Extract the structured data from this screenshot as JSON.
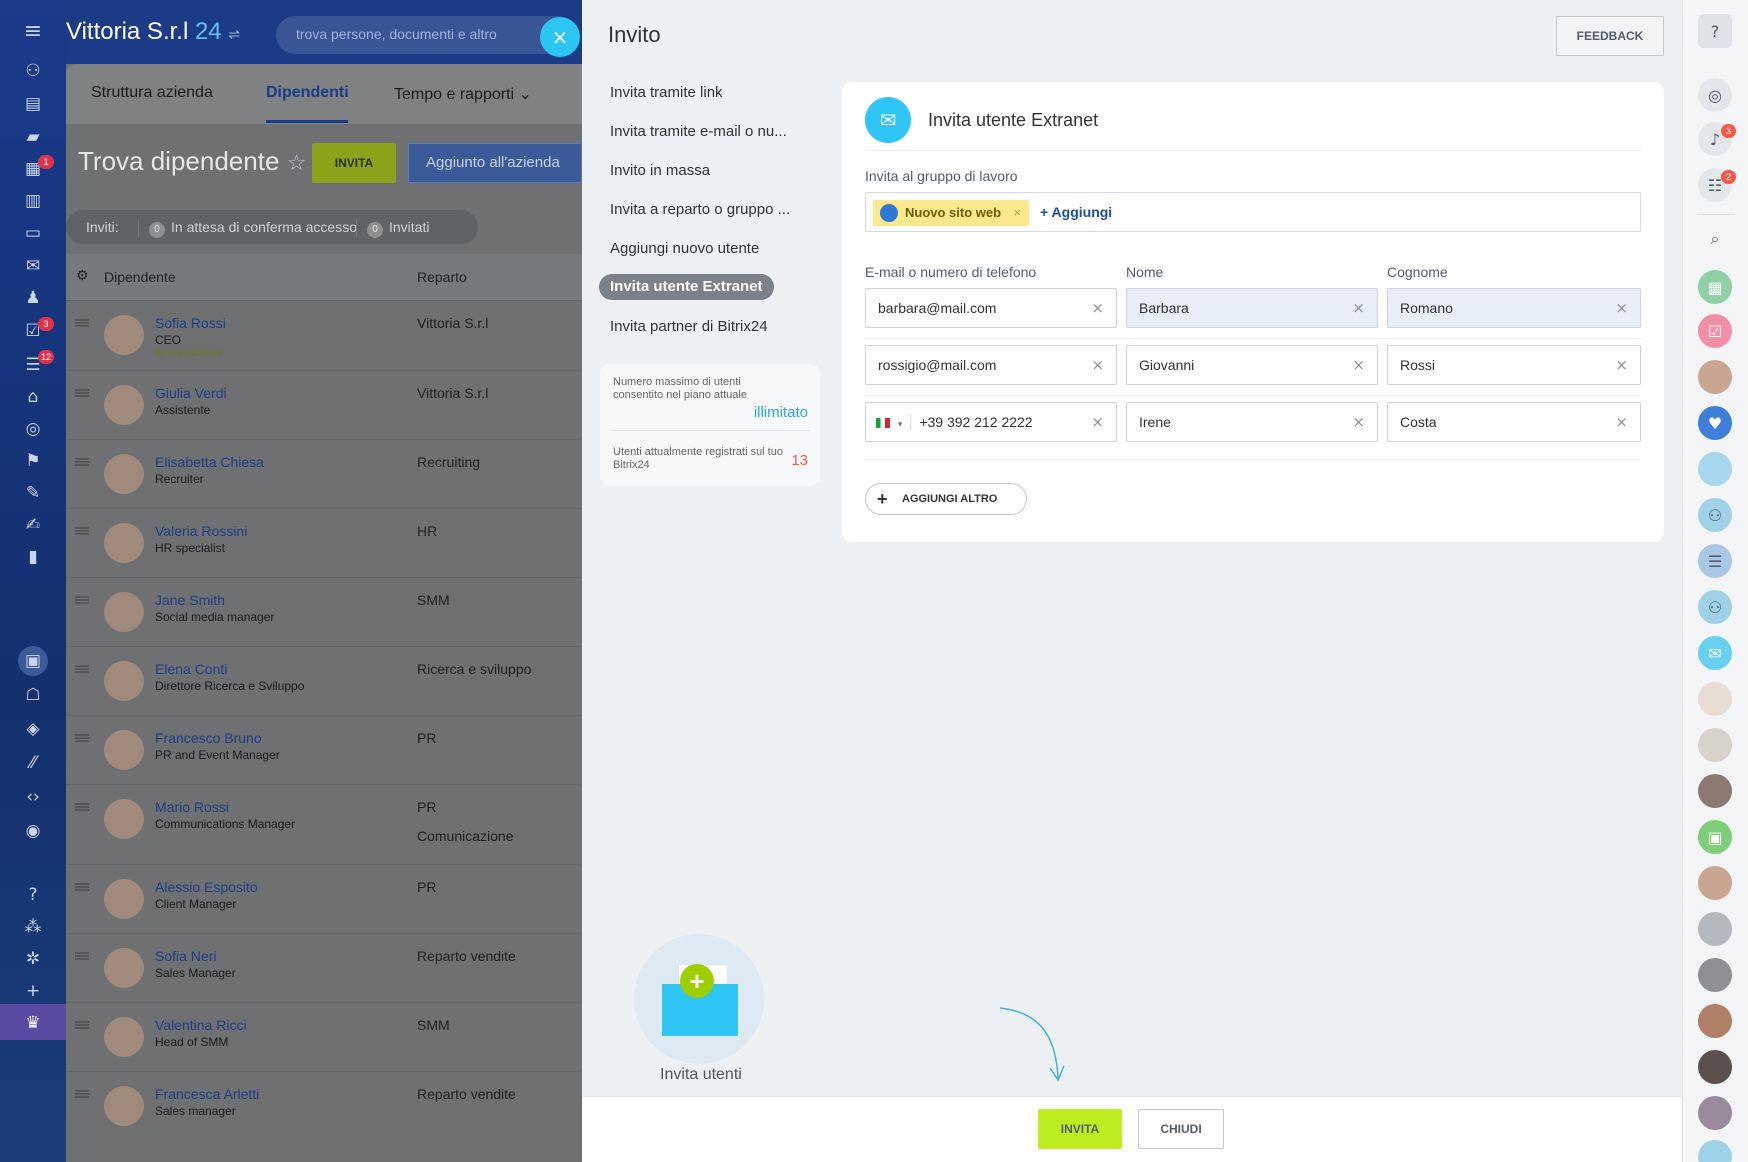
{
  "header": {
    "app_name": "Vittoria S.r.l",
    "app_number": "24",
    "search_placeholder": "trova persone, documenti e altro"
  },
  "left_nav": {
    "badges": {
      "calendar": "1",
      "tasks": "3",
      "feed": "12"
    }
  },
  "background_page": {
    "tabs": [
      "Struttura azienda",
      "Dipendenti",
      "Tempo e rapporti"
    ],
    "title": "Trova dipendente",
    "invite_button": "INVITA",
    "added_button": "Aggiunto all'azienda",
    "invites": {
      "label": "Invitі:",
      "pending_count": "0",
      "pending_label": "In attesa di conferma accesso",
      "invited_count": "0",
      "invited_label": "Invitati"
    },
    "columns": {
      "employee": "Dipendente",
      "department": "Reparto"
    },
    "employees": [
      {
        "name": "Sofia Rossi",
        "position": "CEO",
        "role": "Amministratore",
        "department": "Vittoria S.r.l",
        "department2": ""
      },
      {
        "name": "Giulia Verdi",
        "position": "Assistente",
        "role": "",
        "department": "Vittoria S.r.l",
        "department2": ""
      },
      {
        "name": "Elisabetta Chiesa",
        "position": "Recruiter",
        "role": "",
        "department": "Recruiting",
        "department2": ""
      },
      {
        "name": "Valeria Rossini",
        "position": "HR specialist",
        "role": "",
        "department": "HR",
        "department2": ""
      },
      {
        "name": "Jane Smith",
        "position": "Social media manager",
        "role": "",
        "department": "SMM",
        "department2": ""
      },
      {
        "name": "Elena Conti",
        "position": "Direttore Ricerca e Sviluppo",
        "role": "",
        "department": "Ricerca e sviluppo",
        "department2": ""
      },
      {
        "name": "Francesco Bruno",
        "position": "PR and Event Manager",
        "role": "",
        "department": "PR",
        "department2": ""
      },
      {
        "name": "Mario Rossi",
        "position": "Communications Manager",
        "role": "",
        "department": "PR",
        "department2": "Comunicazione"
      },
      {
        "name": "Alessio Esposito",
        "position": "Client Manager",
        "role": "",
        "department": "PR",
        "department2": ""
      },
      {
        "name": "Sofia Neri",
        "position": "Sales Manager",
        "role": "",
        "department": "Reparto vendite",
        "department2": ""
      },
      {
        "name": "Valentina Ricci",
        "position": "Head of SMM",
        "role": "",
        "department": "SMM",
        "department2": ""
      },
      {
        "name": "Francesca Arletti",
        "position": "Sales manager",
        "role": "",
        "department": "Reparto vendite",
        "department2": ""
      }
    ]
  },
  "slider": {
    "title": "Invito",
    "feedback_button": "FEEDBACK",
    "menu": [
      "Invita tramite link",
      "Invita tramite e-mail o nu...",
      "Invito in massa",
      "Invita a reparto o gruppo ...",
      "Aggiungi nuovo utente",
      "Invita utente Extranet",
      "Invita partner di Bitrix24"
    ],
    "quota": {
      "max_label": "Numero massimo di utenti consentito nel piano attuale",
      "max_value": "illimitato",
      "current_label": "Utenti attualmente registrati sul tuo Bitrix24",
      "current_value": "13"
    },
    "form": {
      "title": "Invita utente Extranet",
      "group_label": "Invita al gruppo di lavoro",
      "group_chip": "Nuovo sito web",
      "add_group": "+ Aggiungi",
      "col_email": "E-mail o numero di telefono",
      "col_name": "Nome",
      "col_surname": "Cognome",
      "rows": [
        {
          "email": "barbara@mail.com",
          "name": "Barbara",
          "surname": "Romano"
        },
        {
          "email": "rossigio@mail.com",
          "name": "Giovanni",
          "surname": "Rossi"
        },
        {
          "email": "+39 392 212 2222",
          "name": "Irene",
          "surname": "Costa"
        }
      ],
      "add_more": "AGGIUNGI ALTRO"
    },
    "illustration_caption": "Invita utenti",
    "footer": {
      "invite": "INVITA",
      "close": "CHIUDI"
    }
  },
  "right_bar": {
    "badges": {
      "notifications": "3",
      "chat": "2"
    }
  },
  "colors": {
    "accent_blue": "#2fc6f6",
    "invite_green": "#bbed21",
    "chip_yellow": "#fbe98c",
    "badge_red": "#f05a4a"
  }
}
